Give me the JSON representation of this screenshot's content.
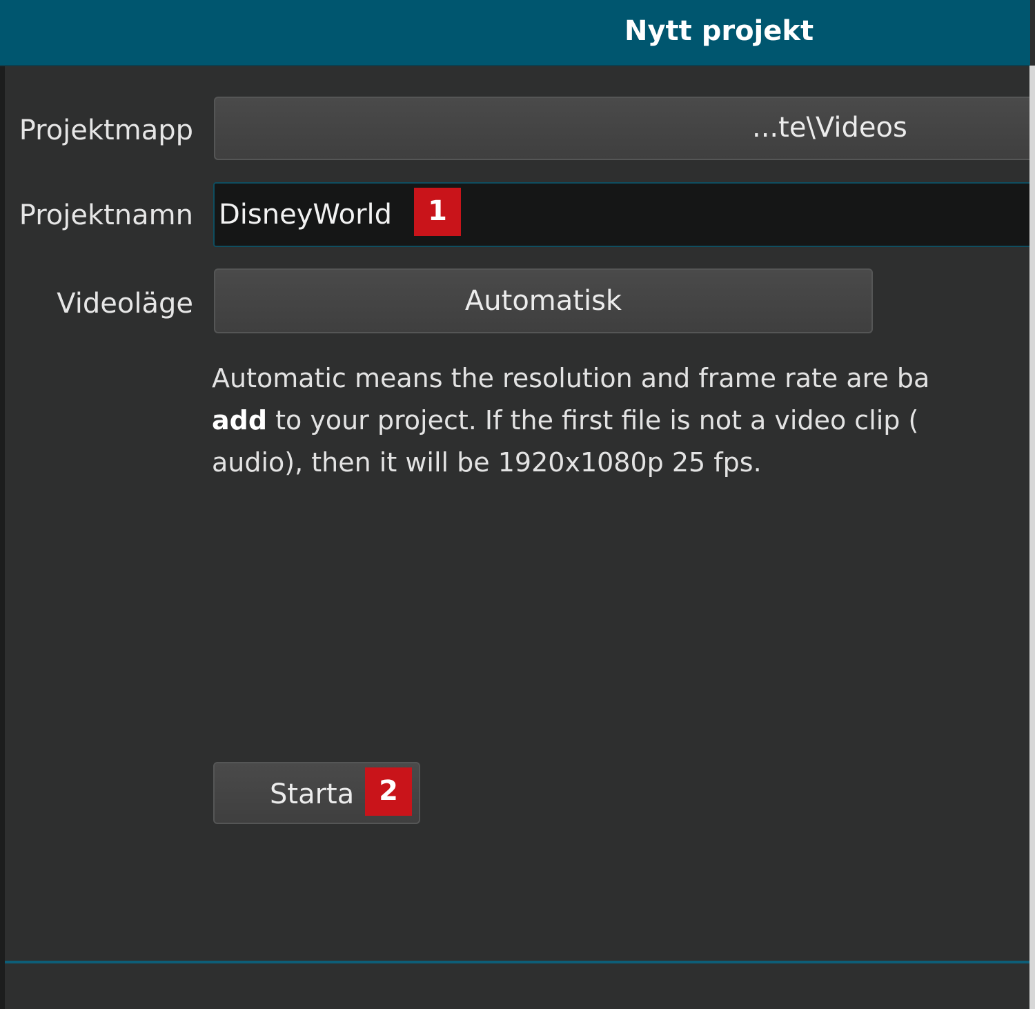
{
  "window": {
    "title": "Nytt projekt"
  },
  "form": {
    "folder_label": "Projektmapp",
    "folder_value": "...te\\Videos",
    "name_label": "Projektnamn",
    "name_value": "DisneyWorld",
    "mode_label": "Videoläge",
    "mode_value": "Automatisk"
  },
  "help": {
    "line1": "Automatic means the resolution and frame rate are ba",
    "line2_bold": "add",
    "line2_rest": " to your project. If the first file is not a video clip (",
    "line3": "audio), then it will be 1920x1080p 25 fps."
  },
  "actions": {
    "start_label": "Starta"
  },
  "annotations": {
    "badge1": "1",
    "badge2": "2"
  },
  "colors": {
    "title_bar": "#00566f",
    "background": "#2e2f2f",
    "badge": "#c9141a",
    "input_border": "#0f4e60"
  }
}
